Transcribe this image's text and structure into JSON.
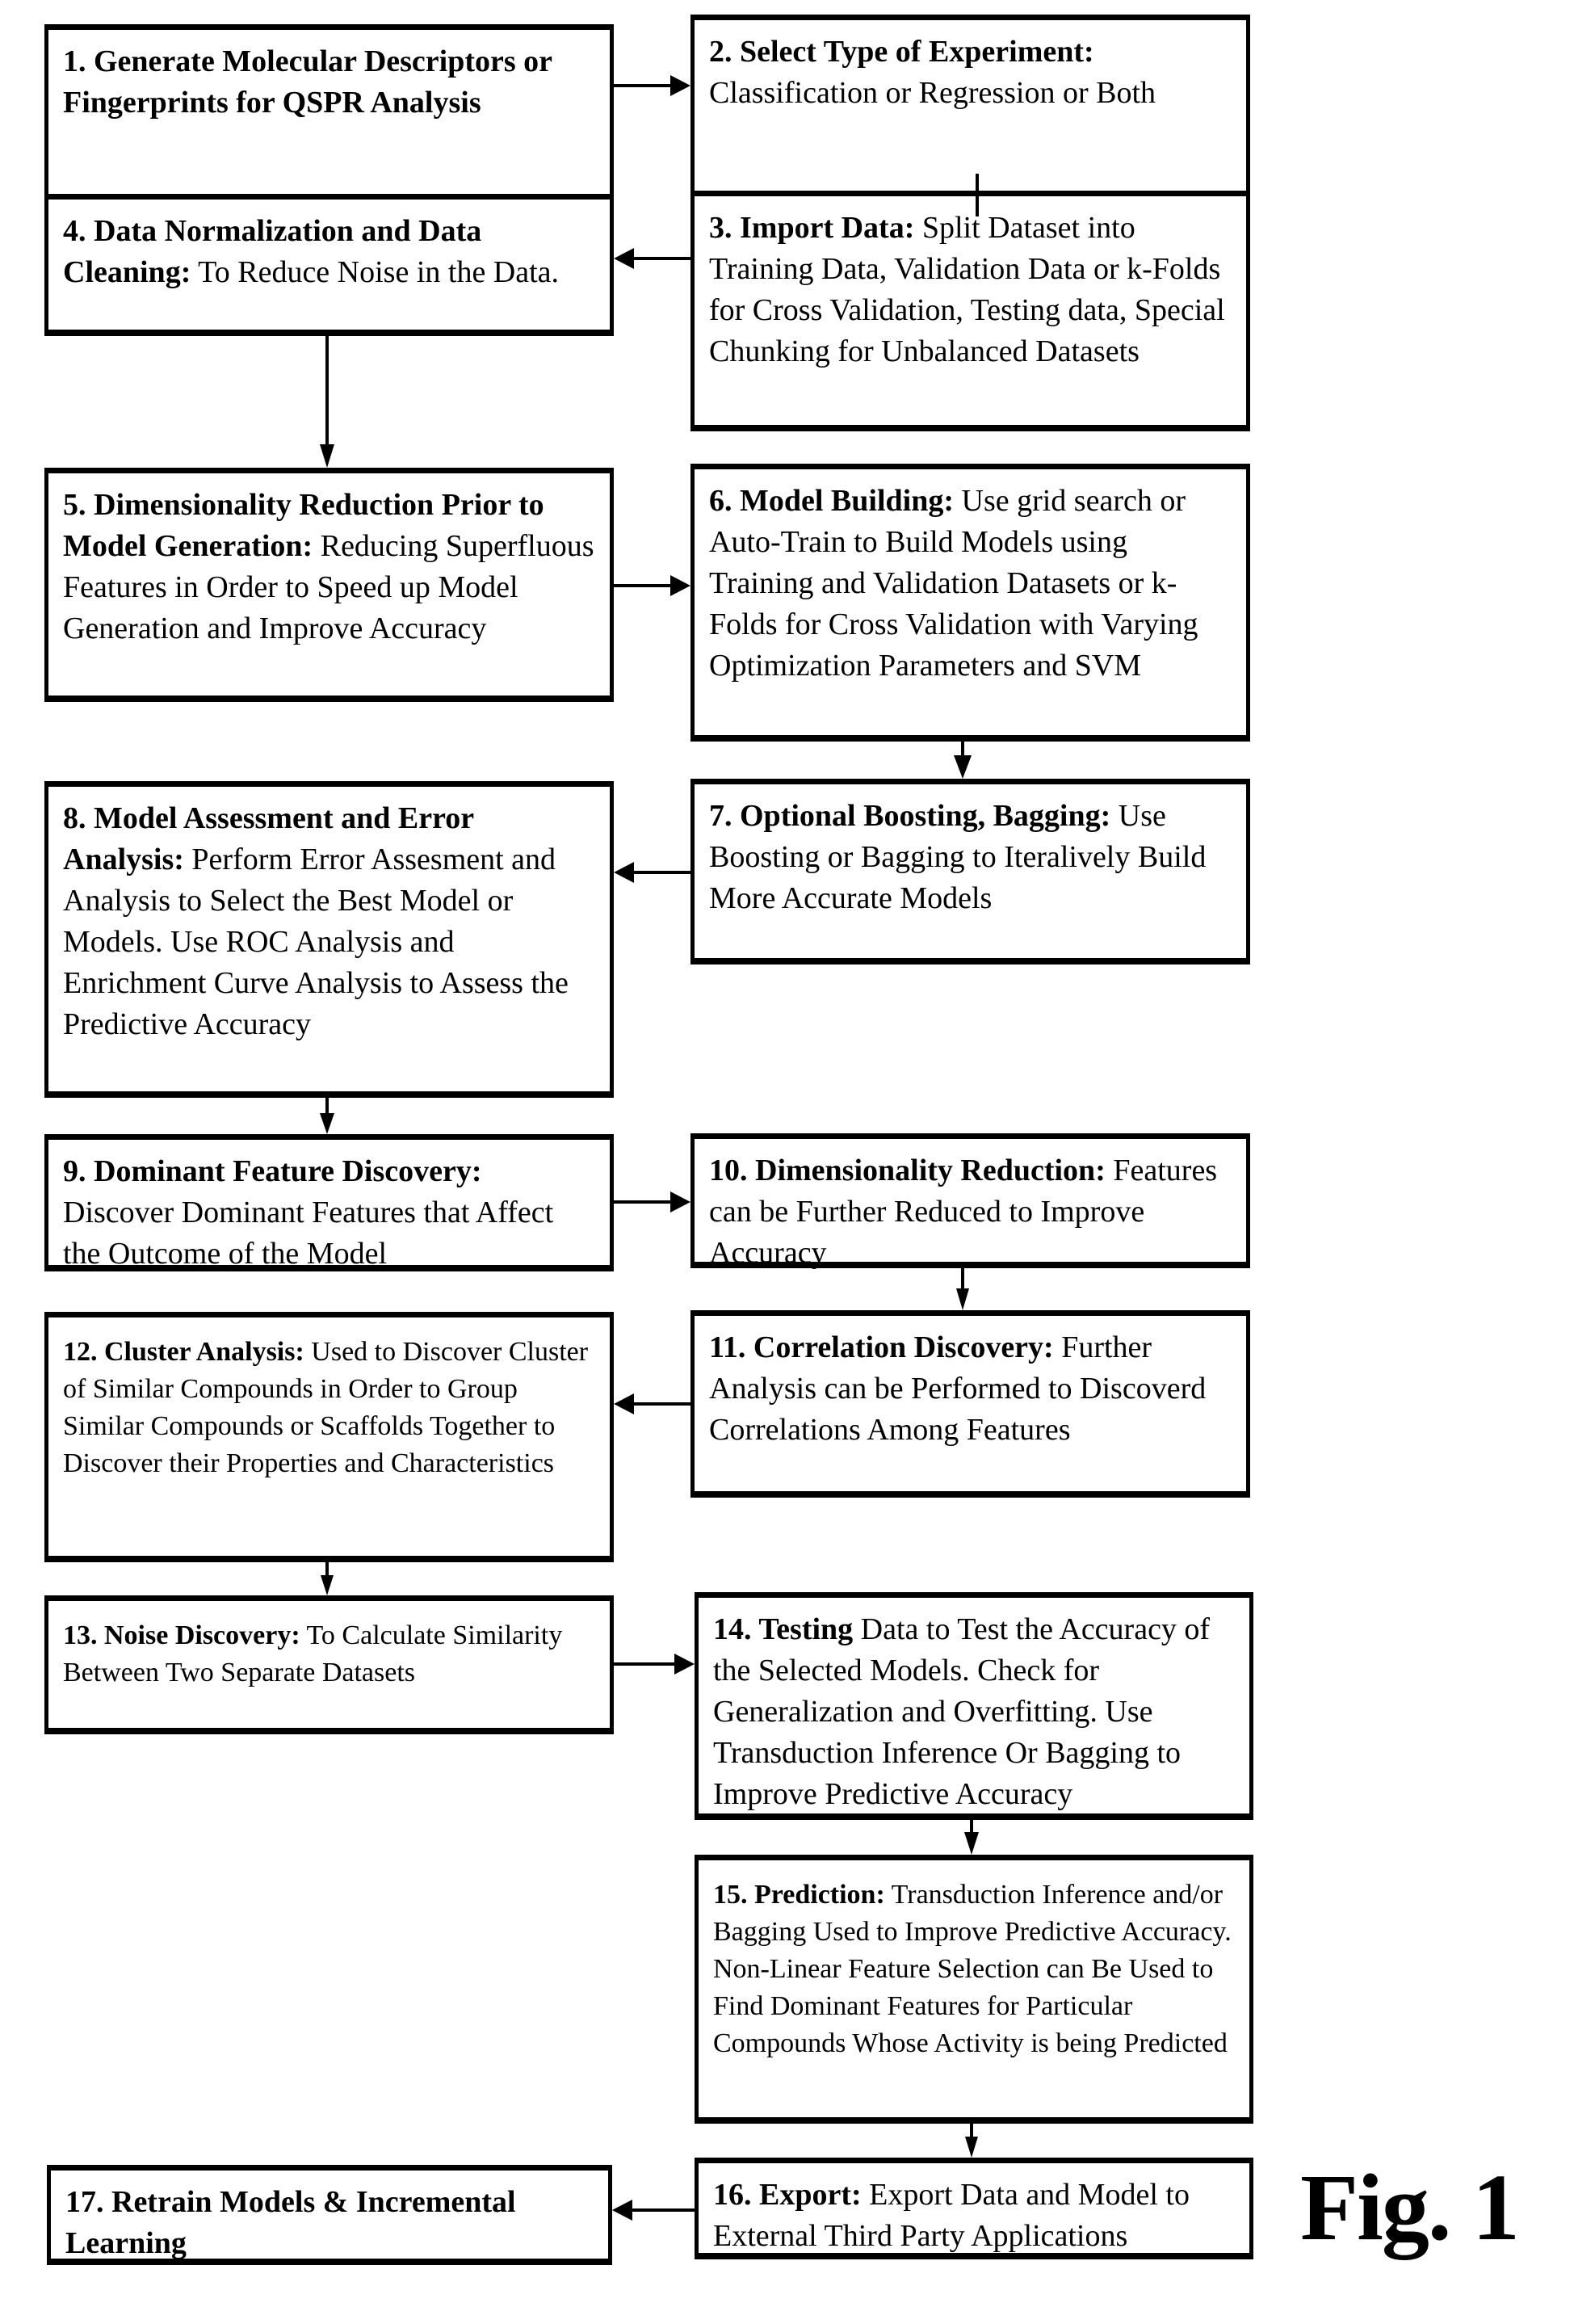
{
  "figure_label": "Fig. 1",
  "steps": [
    {
      "id": "1",
      "title": "1. Generate Molecular Descriptors or Fingerprints for QSPR Analysis",
      "body": ""
    },
    {
      "id": "2",
      "title": "2. Select Type of Experiment:",
      "body": " Classification or Regression or Both"
    },
    {
      "id": "3",
      "title": "3. Import Data:",
      "body": " Split Dataset into Training Data, Validation Data or k-Folds for Cross Validation, Testing data, Special Chunking for Unbalanced Datasets"
    },
    {
      "id": "4",
      "title": "4. Data Normalization and Data Cleaning:",
      "body": " To Reduce Noise in the Data."
    },
    {
      "id": "5",
      "title": "5. Dimensionality Reduction Prior to Model Generation:",
      "body": " Reducing Superfluous Features in Order to Speed up Model Generation and Improve Accuracy"
    },
    {
      "id": "6",
      "title": "6. Model Building:",
      "body": " Use grid search or Auto-Train to Build Models using Training and Validation Datasets or k-Folds for Cross Validation with Varying Optimization Parameters and SVM"
    },
    {
      "id": "7",
      "title": "7. Optional Boosting, Bagging:",
      "body": " Use Boosting or Bagging to Iteralively Build More Accurate Models"
    },
    {
      "id": "8",
      "title": "8. Model Assessment and Error Analysis:",
      "body": " Perform Error Assesment and Analysis to Select the Best Model or Models. Use ROC Analysis and Enrichment Curve Analysis to Assess the Predictive Accuracy"
    },
    {
      "id": "9",
      "title": "9. Dominant Feature Discovery:",
      "body": " Discover Dominant Features that Affect the Outcome of the Model"
    },
    {
      "id": "10",
      "title": "10. Dimensionality Reduction:",
      "body": " Features can be Further Reduced to Improve Accuracy"
    },
    {
      "id": "11",
      "title": "11. Correlation Discovery:",
      "body": " Further Analysis can be Performed to Discoverd Correlations Among Features"
    },
    {
      "id": "12",
      "title": "12. Cluster Analysis:",
      "body": " Used to Discover Cluster of Similar Compounds in Order to Group Similar Compounds or Scaffolds Together to Discover their Properties and Characteristics"
    },
    {
      "id": "13",
      "title": "13. Noise Discovery:",
      "body": "  To Calculate Similarity Between Two Separate Datasets"
    },
    {
      "id": "14",
      "title": "14. Testing",
      "body": " Data to Test the Accuracy of the Selected Models. Check for Generalization and Overfitting. Use Transduction Inference Or Bagging to Improve Predictive Accuracy"
    },
    {
      "id": "15",
      "title": "15. Prediction:",
      "body": " Transduction Inference and/or Bagging Used to Improve Predictive Accuracy. Non-Linear Feature Selection can Be Used to Find Dominant Features for Particular Compounds Whose Activity is being Predicted"
    },
    {
      "id": "16",
      "title": "16. Export:",
      "body": " Export Data and Model to External Third Party Applications"
    },
    {
      "id": "17",
      "title": "17. Retrain Models & Incremental Learning",
      "body": ""
    }
  ],
  "connections": [
    [
      "1",
      "2"
    ],
    [
      "2",
      "3"
    ],
    [
      "3",
      "4"
    ],
    [
      "4",
      "5"
    ],
    [
      "5",
      "6"
    ],
    [
      "6",
      "7"
    ],
    [
      "7",
      "8"
    ],
    [
      "8",
      "9"
    ],
    [
      "9",
      "10"
    ],
    [
      "10",
      "11"
    ],
    [
      "11",
      "12"
    ],
    [
      "12",
      "13"
    ],
    [
      "13",
      "14"
    ],
    [
      "14",
      "15"
    ],
    [
      "15",
      "16"
    ],
    [
      "16",
      "17"
    ]
  ]
}
